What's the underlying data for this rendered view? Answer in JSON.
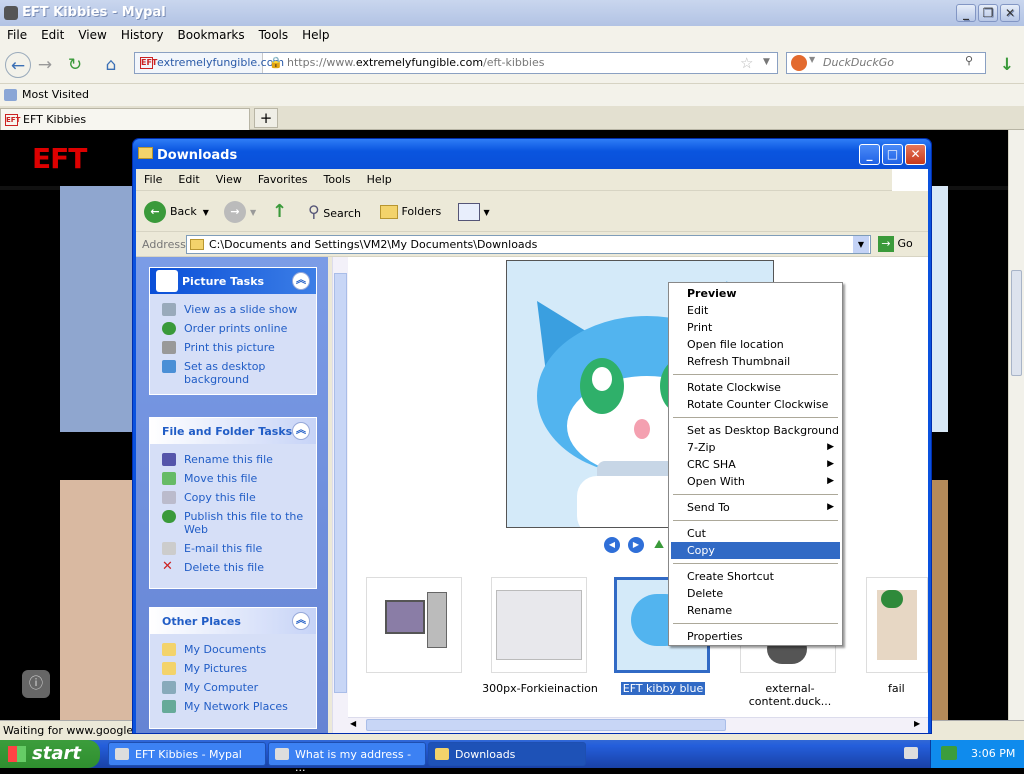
{
  "browser": {
    "title": "EFT Kibbies - Mypal",
    "menu": [
      "File",
      "Edit",
      "View",
      "History",
      "Bookmarks",
      "Tools",
      "Help"
    ],
    "url_identity": "extremelyfungible.com",
    "url": "https://www.extremelyfungible.com/eft-kibbies",
    "url_prefix": "https://www.",
    "url_host": "extremelyfungible.com",
    "url_path": "/eft-kibbies",
    "search_placeholder": "DuckDuckGo",
    "bookmark": "Most Visited",
    "tab": "EFT Kibbies",
    "new_tab": "+",
    "status": "Waiting for www.google-ar",
    "site_logo": "EFT"
  },
  "explorer": {
    "title": "Downloads",
    "menu": [
      "File",
      "Edit",
      "View",
      "Favorites",
      "Tools",
      "Help"
    ],
    "toolbar": {
      "back": "Back",
      "search": "Search",
      "folders": "Folders"
    },
    "address_label": "Address",
    "address": "C:\\Documents and Settings\\VM2\\My Documents\\Downloads",
    "go": "Go",
    "panels": {
      "picture_tasks": {
        "title": "Picture Tasks",
        "items": [
          "View as a slide show",
          "Order prints online",
          "Print this picture",
          "Set as desktop background"
        ]
      },
      "file_tasks": {
        "title": "File and Folder Tasks",
        "items": [
          "Rename this file",
          "Move this file",
          "Copy this file",
          "Publish this file to the Web",
          "E-mail this file",
          "Delete this file"
        ]
      },
      "other_places": {
        "title": "Other Places",
        "items": [
          "My Documents",
          "My Pictures",
          "My Computer",
          "My Network Places"
        ]
      }
    },
    "thumbnails": [
      {
        "label": ""
      },
      {
        "label": "300px-Forkieinaction"
      },
      {
        "label": "EFT kibby blue"
      },
      {
        "label": "external-content.duck..."
      },
      {
        "label": "fail"
      }
    ]
  },
  "context_menu": {
    "groups": [
      [
        "Preview",
        "Edit",
        "Print",
        "Open file location",
        "Refresh Thumbnail"
      ],
      [
        "Rotate Clockwise",
        "Rotate Counter Clockwise"
      ],
      [
        "Set as Desktop Background",
        "7-Zip",
        "CRC SHA",
        "Open With"
      ],
      [
        "Send To"
      ],
      [
        "Cut",
        "Copy"
      ],
      [
        "Create Shortcut",
        "Delete",
        "Rename"
      ],
      [
        "Properties"
      ]
    ],
    "selected": "Copy"
  },
  "taskbar": {
    "start": "start",
    "tasks": [
      "EFT Kibbies - Mypal",
      "What is my address - ...",
      "Downloads"
    ],
    "clock": "3:06 PM"
  },
  "colors": {
    "xp_blue": "#0a52de",
    "selection": "#316ac5",
    "start_green": "#3c9d3c"
  }
}
